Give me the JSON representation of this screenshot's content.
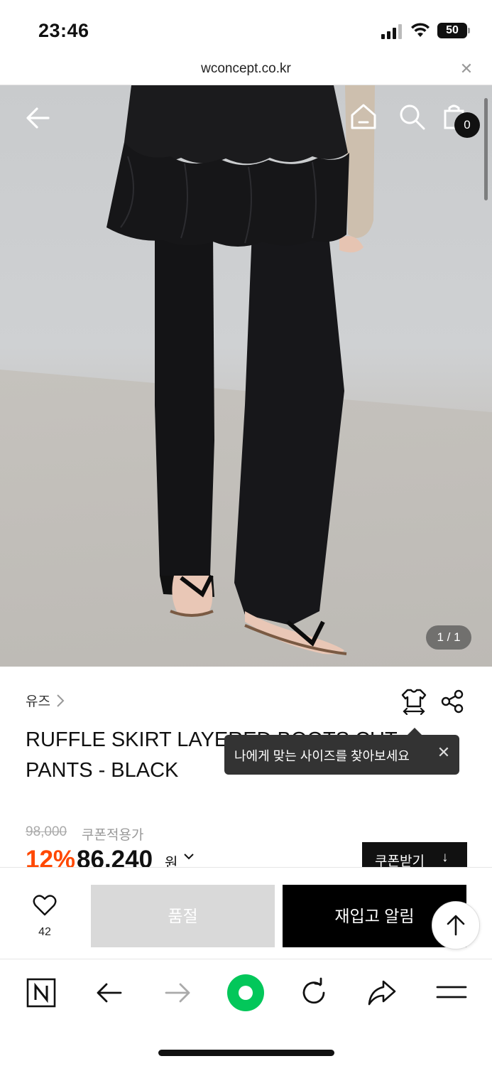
{
  "status_bar": {
    "time": "23:46",
    "battery": "50"
  },
  "browser": {
    "url": "wconcept.co.kr"
  },
  "header": {
    "cart_count": "0"
  },
  "gallery": {
    "page_indicator": "1 / 1"
  },
  "product": {
    "brand": "유즈",
    "title": "RUFFLE SKIRT LAYERED BOOTS CUT PANTS - BLACK",
    "original_price": "98,000",
    "coupon_price_label": "쿠폰적용가",
    "discount": "12%",
    "final_price": "86,240",
    "currency": "원",
    "coupon_button": "쿠폰받기"
  },
  "tooltip": {
    "text": "나에게 맞는 사이즈를 찾아보세요"
  },
  "actions": {
    "like_count": "42",
    "soldout_label": "품절",
    "restock_label": "재입고 알림"
  },
  "colors": {
    "accent_discount": "#ff4800",
    "primary_button": "#000000",
    "disabled_button": "#d9d9d9",
    "naver_green": "#03c75a"
  },
  "icons": [
    "back-arrow-icon",
    "home-icon",
    "search-icon",
    "shopping-bag-icon",
    "size-guide-icon",
    "share-icon",
    "heart-icon",
    "arrow-up-icon",
    "naver-icon",
    "browser-back-icon",
    "browser-forward-icon",
    "green-dot-icon",
    "reload-icon",
    "share-forward-icon",
    "menu-icon"
  ]
}
